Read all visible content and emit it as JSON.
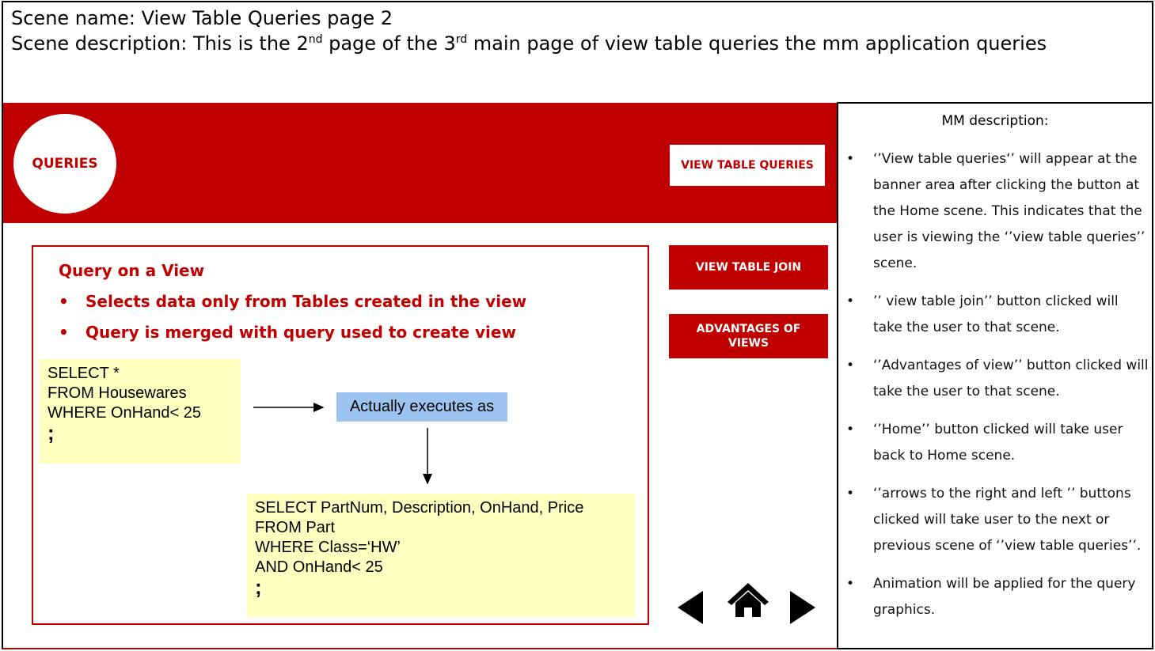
{
  "header": {
    "scene_name": "Scene name: View Table Queries page 2",
    "desc_prefix": "Scene description: This is the 2",
    "sup1": "nd",
    "desc_mid": " page of the 3",
    "sup2": "rd",
    "desc_suffix": " main page of view table queries the mm application queries"
  },
  "banner": {
    "logo_label": "QUERIES",
    "active_button": "VIEW TABLE QUERIES"
  },
  "nav": {
    "join_label": "VIEW TABLE JOIN",
    "advantages_line1": "ADVANTAGES OF",
    "advantages_line2": "VIEWS"
  },
  "content": {
    "title": "Query on a View",
    "bullets": [
      "Selects data only from Tables created in the view",
      "Query is merged with query used to create view"
    ],
    "bullet_symbol": "•",
    "query1": [
      "SELECT *",
      "FROM Housewares",
      "WHERE OnHand< 25"
    ],
    "query1_end": ";",
    "exec_label": "Actually executes as",
    "query2": [
      "SELECT PartNum, Description, OnHand, Price",
      "FROM Part",
      "WHERE Class=‘HW’",
      "AND OnHand< 25"
    ],
    "query2_end": ";"
  },
  "mm": {
    "title": "MM description:",
    "bullet_symbol": "•",
    "items": [
      "‘’View table queries‘’ will appear at the banner area after clicking the button at the  Home scene. This indicates that the user is viewing the ‘’view table queries’’ scene.",
      "’’ view table join’’ button clicked will take the user to that scene.",
      "‘’Advantages of view’’ button clicked will take the user to that scene.",
      "‘’Home’’ button clicked will take user back to Home scene.",
      "‘’arrows to the right and left ’’ buttons clicked will take user to the next or previous  scene of ‘’view table queries’’.",
      "Animation will be applied for the query graphics."
    ]
  },
  "colors": {
    "brand_red": "#c00000",
    "code_bg": "#ffffc0",
    "exec_bg": "#9dc3f0"
  },
  "icons": {
    "prev": "triangle-left-icon",
    "home": "home-icon",
    "next": "triangle-right-icon"
  }
}
